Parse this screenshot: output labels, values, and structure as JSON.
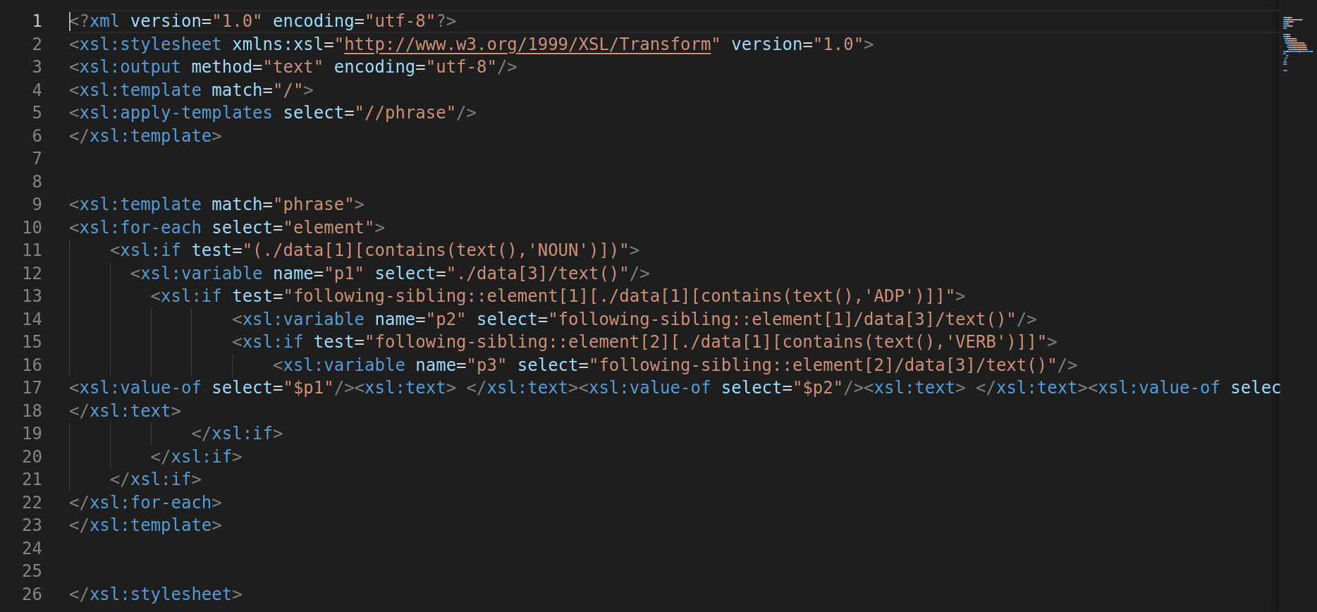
{
  "editor": {
    "lines": [
      {
        "number": "1",
        "current": true,
        "tokens": [
          {
            "kind": "punct",
            "text": "<?"
          },
          {
            "kind": "tag",
            "text": "xml"
          },
          {
            "kind": "attr",
            "text": " version"
          },
          {
            "kind": "eq",
            "text": "="
          },
          {
            "kind": "str",
            "text": "\"1.0\""
          },
          {
            "kind": "attr",
            "text": " encoding"
          },
          {
            "kind": "eq",
            "text": "="
          },
          {
            "kind": "str",
            "text": "\"utf-8\""
          },
          {
            "kind": "punct",
            "text": "?>"
          }
        ]
      },
      {
        "number": "2",
        "current": false,
        "tokens": [
          {
            "kind": "punct",
            "text": "<"
          },
          {
            "kind": "tag",
            "text": "xsl:stylesheet"
          },
          {
            "kind": "attr",
            "text": " xmlns:xsl"
          },
          {
            "kind": "eq",
            "text": "="
          },
          {
            "kind": "str",
            "text": "\""
          },
          {
            "kind": "link",
            "text": "http://www.w3.org/1999/XSL/Transform"
          },
          {
            "kind": "str",
            "text": "\""
          },
          {
            "kind": "attr",
            "text": " version"
          },
          {
            "kind": "eq",
            "text": "="
          },
          {
            "kind": "str",
            "text": "\"1.0\""
          },
          {
            "kind": "punct",
            "text": ">"
          }
        ]
      },
      {
        "number": "3",
        "current": false,
        "tokens": [
          {
            "kind": "punct",
            "text": "<"
          },
          {
            "kind": "tag",
            "text": "xsl:output"
          },
          {
            "kind": "attr",
            "text": " method"
          },
          {
            "kind": "eq",
            "text": "="
          },
          {
            "kind": "str",
            "text": "\"text\""
          },
          {
            "kind": "attr",
            "text": " encoding"
          },
          {
            "kind": "eq",
            "text": "="
          },
          {
            "kind": "str",
            "text": "\"utf-8\""
          },
          {
            "kind": "punct",
            "text": "/>"
          }
        ]
      },
      {
        "number": "4",
        "current": false,
        "tokens": [
          {
            "kind": "punct",
            "text": "<"
          },
          {
            "kind": "tag",
            "text": "xsl:template"
          },
          {
            "kind": "attr",
            "text": " match"
          },
          {
            "kind": "eq",
            "text": "="
          },
          {
            "kind": "str",
            "text": "\"/\""
          },
          {
            "kind": "punct",
            "text": ">"
          }
        ]
      },
      {
        "number": "5",
        "current": false,
        "tokens": [
          {
            "kind": "punct",
            "text": "<"
          },
          {
            "kind": "tag",
            "text": "xsl:apply-templates"
          },
          {
            "kind": "attr",
            "text": " select"
          },
          {
            "kind": "eq",
            "text": "="
          },
          {
            "kind": "str",
            "text": "\"//phrase\""
          },
          {
            "kind": "punct",
            "text": "/>"
          }
        ]
      },
      {
        "number": "6",
        "current": false,
        "tokens": [
          {
            "kind": "punct",
            "text": "</"
          },
          {
            "kind": "tag",
            "text": "xsl:template"
          },
          {
            "kind": "punct",
            "text": ">"
          }
        ]
      },
      {
        "number": "7",
        "current": false
      },
      {
        "number": "8",
        "current": false
      },
      {
        "number": "9",
        "current": false,
        "tokens": [
          {
            "kind": "punct",
            "text": "<"
          },
          {
            "kind": "tag",
            "text": "xsl:template"
          },
          {
            "kind": "attr",
            "text": " match"
          },
          {
            "kind": "eq",
            "text": "="
          },
          {
            "kind": "str",
            "text": "\"phrase\""
          },
          {
            "kind": "punct",
            "text": ">"
          }
        ]
      },
      {
        "number": "10",
        "current": false,
        "tokens": [
          {
            "kind": "punct",
            "text": "<"
          },
          {
            "kind": "tag",
            "text": "xsl:for-each"
          },
          {
            "kind": "attr",
            "text": " select"
          },
          {
            "kind": "eq",
            "text": "="
          },
          {
            "kind": "str",
            "text": "\"element\""
          },
          {
            "kind": "punct",
            "text": ">"
          }
        ]
      },
      {
        "number": "11",
        "current": false,
        "tokens": [
          {
            "kind": "punct",
            "text": "    <"
          },
          {
            "kind": "tag",
            "text": "xsl:if"
          },
          {
            "kind": "attr",
            "text": " test"
          },
          {
            "kind": "eq",
            "text": "="
          },
          {
            "kind": "str",
            "text": "\"(./data[1][contains(text(),'NOUN')])\""
          },
          {
            "kind": "punct",
            "text": ">"
          }
        ]
      },
      {
        "number": "12",
        "current": false,
        "tokens": [
          {
            "kind": "punct",
            "text": "      <"
          },
          {
            "kind": "tag",
            "text": "xsl:variable"
          },
          {
            "kind": "attr",
            "text": " name"
          },
          {
            "kind": "eq",
            "text": "="
          },
          {
            "kind": "str",
            "text": "\"p1\""
          },
          {
            "kind": "attr",
            "text": " select"
          },
          {
            "kind": "eq",
            "text": "="
          },
          {
            "kind": "str",
            "text": "\"./data[3]/text()\""
          },
          {
            "kind": "punct",
            "text": "/>"
          }
        ]
      },
      {
        "number": "13",
        "current": false,
        "tokens": [
          {
            "kind": "punct",
            "text": "        <"
          },
          {
            "kind": "tag",
            "text": "xsl:if"
          },
          {
            "kind": "attr",
            "text": " test"
          },
          {
            "kind": "eq",
            "text": "="
          },
          {
            "kind": "str",
            "text": "\"following-sibling::element[1][./data[1][contains(text(),'ADP')]]\""
          },
          {
            "kind": "punct",
            "text": ">"
          }
        ]
      },
      {
        "number": "14",
        "current": false,
        "tokens": [
          {
            "kind": "punct",
            "text": "                <"
          },
          {
            "kind": "tag",
            "text": "xsl:variable"
          },
          {
            "kind": "attr",
            "text": " name"
          },
          {
            "kind": "eq",
            "text": "="
          },
          {
            "kind": "str",
            "text": "\"p2\""
          },
          {
            "kind": "attr",
            "text": " select"
          },
          {
            "kind": "eq",
            "text": "="
          },
          {
            "kind": "str",
            "text": "\"following-sibling::element[1]/data[3]/text()\""
          },
          {
            "kind": "punct",
            "text": "/>"
          }
        ]
      },
      {
        "number": "15",
        "current": false,
        "tokens": [
          {
            "kind": "punct",
            "text": "                <"
          },
          {
            "kind": "tag",
            "text": "xsl:if"
          },
          {
            "kind": "attr",
            "text": " test"
          },
          {
            "kind": "eq",
            "text": "="
          },
          {
            "kind": "str",
            "text": "\"following-sibling::element[2][./data[1][contains(text(),'VERB')]]\""
          },
          {
            "kind": "punct",
            "text": ">"
          }
        ]
      },
      {
        "number": "16",
        "current": false,
        "tokens": [
          {
            "kind": "punct",
            "text": "                    <"
          },
          {
            "kind": "tag",
            "text": "xsl:variable"
          },
          {
            "kind": "attr",
            "text": " name"
          },
          {
            "kind": "eq",
            "text": "="
          },
          {
            "kind": "str",
            "text": "\"p3\""
          },
          {
            "kind": "attr",
            "text": " select"
          },
          {
            "kind": "eq",
            "text": "="
          },
          {
            "kind": "str",
            "text": "\"following-sibling::element[2]/data[3]/text()\""
          },
          {
            "kind": "punct",
            "text": "/>"
          }
        ]
      },
      {
        "number": "17",
        "current": false,
        "tokens": [
          {
            "kind": "punct",
            "text": "<"
          },
          {
            "kind": "tag",
            "text": "xsl:value-of"
          },
          {
            "kind": "attr",
            "text": " select"
          },
          {
            "kind": "eq",
            "text": "="
          },
          {
            "kind": "str",
            "text": "\"$p1\""
          },
          {
            "kind": "punct",
            "text": "/><"
          },
          {
            "kind": "tag",
            "text": "xsl:text"
          },
          {
            "kind": "punct",
            "text": "> </"
          },
          {
            "kind": "tag",
            "text": "xsl:text"
          },
          {
            "kind": "punct",
            "text": "><"
          },
          {
            "kind": "tag",
            "text": "xsl:value-of"
          },
          {
            "kind": "attr",
            "text": " select"
          },
          {
            "kind": "eq",
            "text": "="
          },
          {
            "kind": "str",
            "text": "\"$p2\""
          },
          {
            "kind": "punct",
            "text": "/><"
          },
          {
            "kind": "tag",
            "text": "xsl:text"
          },
          {
            "kind": "punct",
            "text": "> </"
          },
          {
            "kind": "tag",
            "text": "xsl:text"
          },
          {
            "kind": "punct",
            "text": "><"
          },
          {
            "kind": "tag",
            "text": "xsl:value-of"
          },
          {
            "kind": "attr",
            "text": " selec"
          }
        ]
      },
      {
        "number": "18",
        "current": false,
        "tokens": [
          {
            "kind": "punct",
            "text": "</"
          },
          {
            "kind": "tag",
            "text": "xsl:text"
          },
          {
            "kind": "punct",
            "text": ">"
          }
        ]
      },
      {
        "number": "19",
        "current": false,
        "tokens": [
          {
            "kind": "punct",
            "text": "            </"
          },
          {
            "kind": "tag",
            "text": "xsl:if"
          },
          {
            "kind": "punct",
            "text": ">"
          }
        ]
      },
      {
        "number": "20",
        "current": false,
        "tokens": [
          {
            "kind": "punct",
            "text": "        </"
          },
          {
            "kind": "tag",
            "text": "xsl:if"
          },
          {
            "kind": "punct",
            "text": ">"
          }
        ]
      },
      {
        "number": "21",
        "current": false,
        "tokens": [
          {
            "kind": "punct",
            "text": "    </"
          },
          {
            "kind": "tag",
            "text": "xsl:if"
          },
          {
            "kind": "punct",
            "text": ">"
          }
        ]
      },
      {
        "number": "22",
        "current": false,
        "tokens": [
          {
            "kind": "punct",
            "text": "</"
          },
          {
            "kind": "tag",
            "text": "xsl:for-each"
          },
          {
            "kind": "punct",
            "text": ">"
          }
        ]
      },
      {
        "number": "23",
        "current": false,
        "tokens": [
          {
            "kind": "punct",
            "text": "</"
          },
          {
            "kind": "tag",
            "text": "xsl:template"
          },
          {
            "kind": "punct",
            "text": ">"
          }
        ]
      },
      {
        "number": "24",
        "current": false
      },
      {
        "number": "25",
        "current": false
      },
      {
        "number": "26",
        "current": false,
        "tokens": [
          {
            "kind": "punct",
            "text": "</"
          },
          {
            "kind": "tag",
            "text": "xsl:stylesheet"
          },
          {
            "kind": "punct",
            "text": ">"
          }
        ]
      }
    ]
  }
}
